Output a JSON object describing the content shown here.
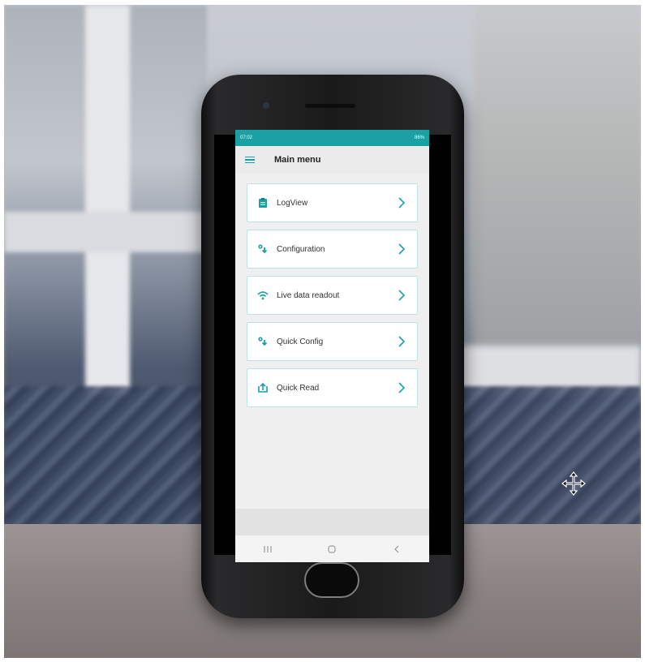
{
  "status_bar": {
    "time": "07:02",
    "battery": "86%"
  },
  "app_bar": {
    "title": "Main menu"
  },
  "menu_items": [
    {
      "label": "LogView",
      "icon": "clipboard-icon"
    },
    {
      "label": "Configuration",
      "icon": "config-icon"
    },
    {
      "label": "Live data readout",
      "icon": "wifi-icon"
    },
    {
      "label": "Quick Config",
      "icon": "config-icon"
    },
    {
      "label": "Quick Read",
      "icon": "upload-icon"
    }
  ],
  "colors": {
    "accent": "#1aa1a3",
    "card_border": "#bfe3e3"
  }
}
